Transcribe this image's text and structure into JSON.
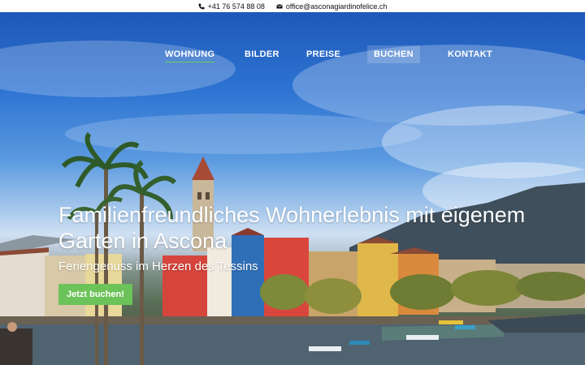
{
  "contact": {
    "phone": "+41 76 574 88 08",
    "email": "office@asconagiardinofelice.ch",
    "phone_icon": "phone-icon",
    "email_icon": "envelope-icon"
  },
  "nav": {
    "items": [
      {
        "label": "WOHNUNG",
        "active": true
      },
      {
        "label": "BILDER",
        "active": false
      },
      {
        "label": "PREISE",
        "active": false
      },
      {
        "label": "BUCHEN",
        "active": false,
        "highlighted": true
      },
      {
        "label": "KONTAKT",
        "active": false
      }
    ]
  },
  "hero": {
    "title": "Familienfreundliches Wohnerlebnis mit eigenem Garten in Ascona",
    "subtitle": "Feriengenuss im Herzen des Tessins",
    "button_label": "Jetzt buchen!"
  },
  "colors": {
    "accent_green": "#6cc359",
    "nav_text": "#ffffff",
    "topbar_bg": "#ffffff"
  }
}
